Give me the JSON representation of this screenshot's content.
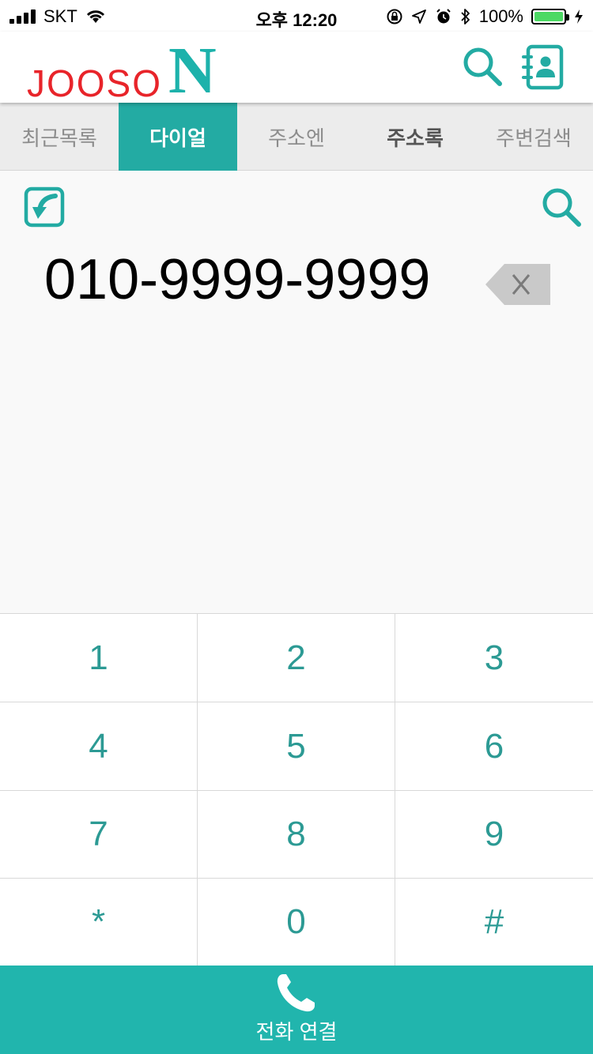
{
  "status_bar": {
    "carrier": "SKT",
    "time": "오후 12:20",
    "battery": "100%",
    "battery_level": 1.0
  },
  "header": {
    "logo_text": "JOOSO",
    "logo_letter": "N",
    "search_icon": "search-icon",
    "contacts_icon": "contacts-book-icon"
  },
  "tabs": [
    {
      "label": "최근목록",
      "active": false
    },
    {
      "label": "다이얼",
      "active": true
    },
    {
      "label": "주소엔",
      "active": false
    },
    {
      "label": "주소록",
      "active": false
    },
    {
      "label": "주변검색",
      "active": false
    }
  ],
  "dial": {
    "number": "010-9999-9999",
    "import_icon": "import-arrow-icon",
    "search_icon": "search-icon",
    "backspace_icon": "backspace-icon"
  },
  "keypad": [
    "1",
    "2",
    "3",
    "4",
    "5",
    "6",
    "7",
    "8",
    "9",
    "*",
    "0",
    "#"
  ],
  "call": {
    "label": "전화 연결",
    "icon": "phone-icon"
  },
  "colors": {
    "accent": "#21b5ad",
    "logo_red": "#e8242a",
    "tab_bg": "#ececec"
  }
}
